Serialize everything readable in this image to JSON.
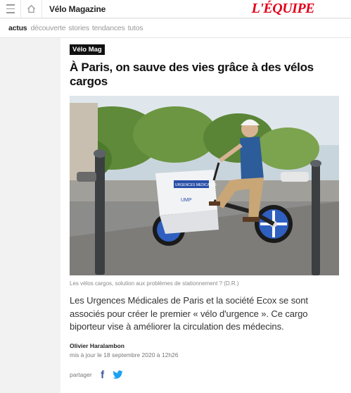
{
  "header": {
    "section_name": "Vélo Magazine",
    "logo_text": "L'ÉQUIPE",
    "brand_color": "#e2001a",
    "menu_icon": "hamburger-icon",
    "home_icon": "home-icon"
  },
  "subnav": {
    "items": [
      {
        "label": "actus",
        "active": true
      },
      {
        "label": "découverte",
        "active": false
      },
      {
        "label": "stories",
        "active": false
      },
      {
        "label": "tendances",
        "active": false
      },
      {
        "label": "tutos",
        "active": false
      }
    ]
  },
  "article": {
    "tag": "Vélo Mag",
    "title": "À Paris, on sauve des vies grâce à des vélos cargos",
    "image_caption": "Les vélos cargos, solution aux problèmes de stationnement ? (D.R.)",
    "image_text": {
      "box_label": "URGENCES MEDICALES",
      "box_logo": "UMP"
    },
    "chapo": "Les Urgences Médicales de Paris et la société Ecox se sont associés pour créer le premier « vélo d'urgence ». Ce cargo biporteur vise à améliorer la circulation des médecins.",
    "author": "Olivier Haralambon",
    "date": "mis à jour le 18 septembre 2020 à 12h26",
    "share": {
      "label": "partager",
      "facebook_icon": "facebook-icon",
      "twitter_icon": "twitter-icon"
    }
  }
}
